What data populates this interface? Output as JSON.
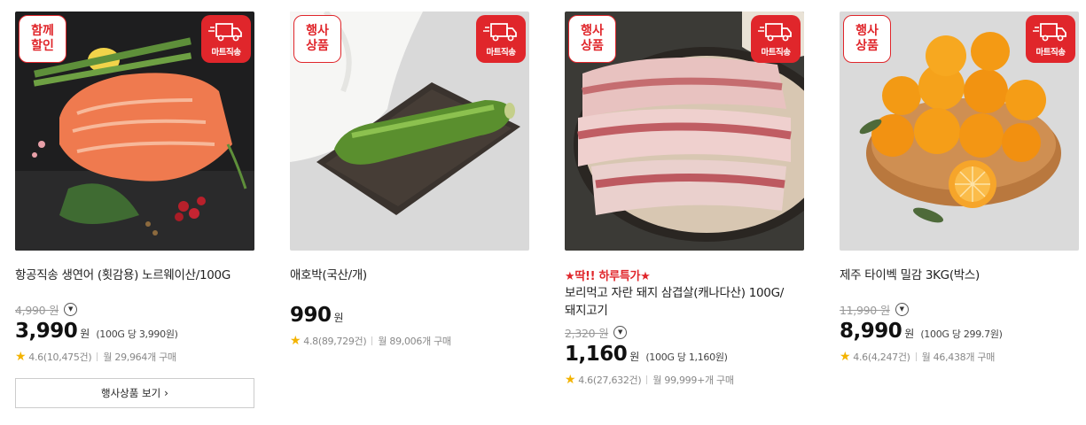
{
  "products": [
    {
      "promo_badge": "함께\n할인",
      "ship_badge": "마트직송",
      "special": "",
      "title": "항공직송 생연어 (횟감용) 노르웨이산/100G",
      "original_price": "4,990 원",
      "price": "3,990",
      "currency": "원",
      "unit_price": "(100G 당 3,990원)",
      "rating": "4.6(10,475건)",
      "monthly": "월 29,964개 구매",
      "button": "행사상품 보기",
      "button_icon": "chevron-right-icon"
    },
    {
      "promo_badge": "행사\n상품",
      "ship_badge": "마트직송",
      "special": "",
      "title": "애호박(국산/개)",
      "original_price": "",
      "price": "990",
      "currency": "원",
      "unit_price": "",
      "rating": "4.8(89,729건)",
      "monthly": "월 89,006개 구매"
    },
    {
      "promo_badge": "행사\n상품",
      "ship_badge": "마트직송",
      "special": "★딱!! 하루특가★",
      "title": "보리먹고 자란 돼지 삼겹살(캐나다산) 100G/돼지고기",
      "original_price": "2,320 원",
      "price": "1,160",
      "currency": "원",
      "unit_price": "(100G 당 1,160원)",
      "rating": "4.6(27,632건)",
      "monthly": "월 99,999+개 구매"
    },
    {
      "promo_badge": "행사\n상품",
      "ship_badge": "마트직송",
      "special": "",
      "title": "제주 타이벡 밀감 3KG(박스)",
      "original_price": "11,990 원",
      "price": "8,990",
      "currency": "원",
      "unit_price": "(100G 당 299.7원)",
      "rating": "4.6(4,247건)",
      "monthly": "월 46,438개 구매"
    }
  ],
  "colors": {
    "accent": "#e0262b",
    "star": "#f3b300"
  }
}
